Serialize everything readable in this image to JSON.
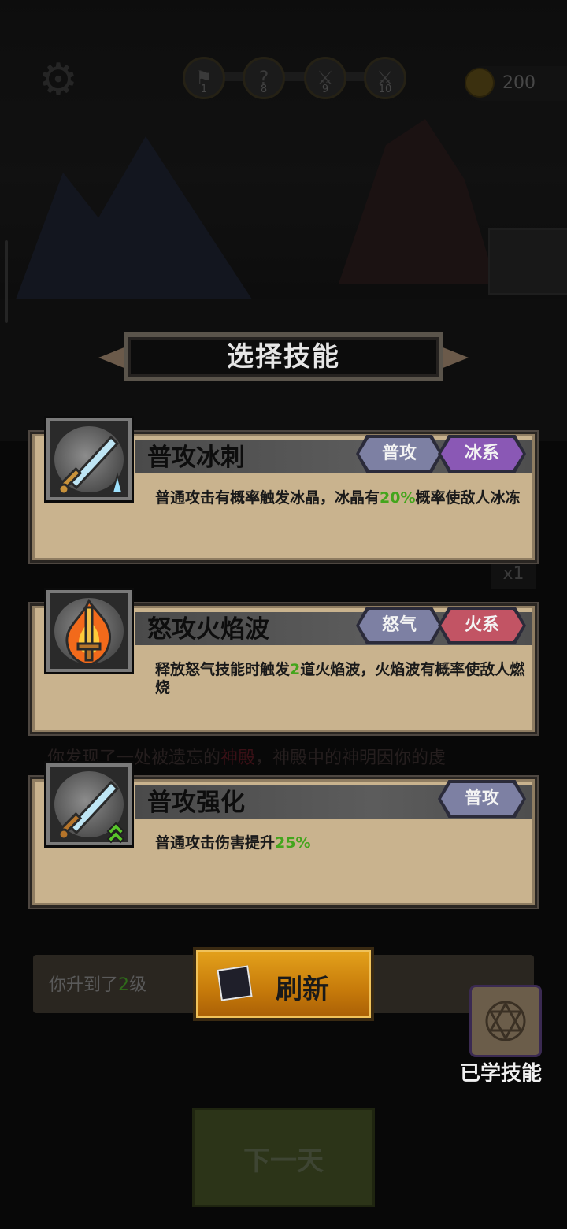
{
  "hud": {
    "stages": [
      {
        "num": "1",
        "icon": "flag-icon"
      },
      {
        "num": "8",
        "icon": "question-icon"
      },
      {
        "num": "9",
        "icon": "crossed-swords-icon"
      },
      {
        "num": "10",
        "icon": "crossed-swords-icon"
      }
    ],
    "progress": 0.12,
    "coins": "200"
  },
  "panel": {
    "title": "选择技能"
  },
  "skills": [
    {
      "name": "普攻冰刺",
      "desc_parts": [
        "普通攻击有概率触发冰晶，冰晶有",
        "20%",
        "概率使敌人冰冻"
      ],
      "tags": [
        "普攻",
        "冰系"
      ],
      "icon": "ice-sword-icon"
    },
    {
      "name": "怒攻火焰波",
      "desc_parts": [
        "释放怒气技能时触发",
        "2",
        "道火焰波，火焰波有概率使敌人燃烧"
      ],
      "tags": [
        "怒气",
        "火系"
      ],
      "icon": "fire-sword-icon"
    },
    {
      "name": "普攻强化",
      "desc_parts": [
        "普通攻击伤害提升",
        "25%",
        ""
      ],
      "tags": [
        "普攻"
      ],
      "icon": "sword-upgrade-icon"
    }
  ],
  "background": {
    "speed": "x1",
    "event_text_pre": "你发现了一处被遗忘的",
    "event_text_red": "神殿",
    "event_text_post": "，神殿中的神明因你的虔",
    "log_pre": "你升到了",
    "log_num": "2",
    "log_post": "级"
  },
  "buttons": {
    "refresh": "刷新",
    "learned_skills": "已学技能",
    "next_day": "下一天"
  },
  "colors": {
    "highlight_green": "#43a51c",
    "tag_gray": "#7d80a3",
    "tag_purple": "#8a58b5",
    "tag_red": "#c25464",
    "card_bg": "#c9b38e",
    "refresh_orange": "#e4a21c"
  }
}
